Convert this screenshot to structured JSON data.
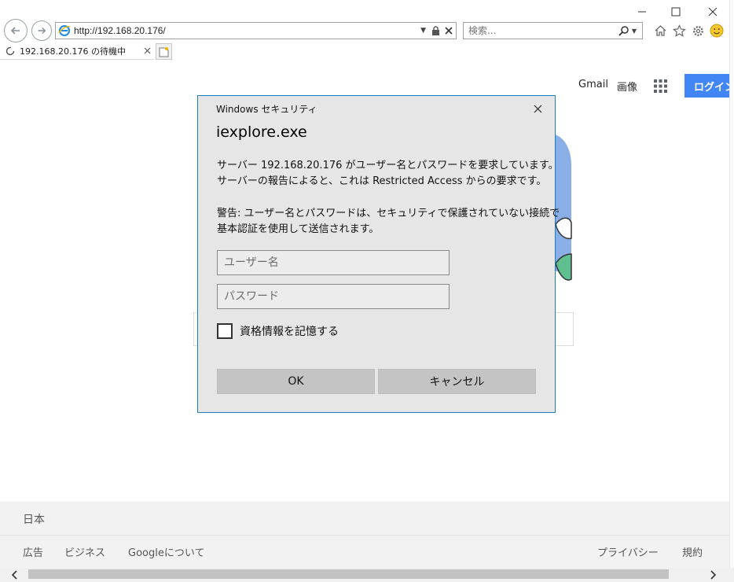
{
  "browser": {
    "address_url": "http://192.168.20.176/",
    "search_placeholder": "検索...",
    "tab_title": "192.168.20.176 の待機中",
    "accent_color": "#1e7fbf"
  },
  "page": {
    "gmail_label": "Gmail",
    "images_label": "画像",
    "login_label": "ログイン",
    "login_color": "#4285f4",
    "footer": {
      "country": "日本",
      "left_links": [
        "広告",
        "ビジネス",
        "Googleについて"
      ],
      "right_links": [
        "プライバシー",
        "規約"
      ]
    }
  },
  "dialog": {
    "caption": "Windows セキュリティ",
    "title": "iexplore.exe",
    "message_lines": [
      "サーバー 192.168.20.176 がユーザー名とパスワードを要求しています。",
      "サーバーの報告によると、これは Restricted Access からの要求です。"
    ],
    "warning_lines": [
      "警告: ユーザー名とパスワードは、セキュリティで保護されていない接続で",
      "基本認証を使用して送信されます。"
    ],
    "username_placeholder": "ユーザー名",
    "password_placeholder": "パスワード",
    "remember_label": "資格情報を記憶する",
    "ok_label": "OK",
    "cancel_label": "キャンセル"
  }
}
